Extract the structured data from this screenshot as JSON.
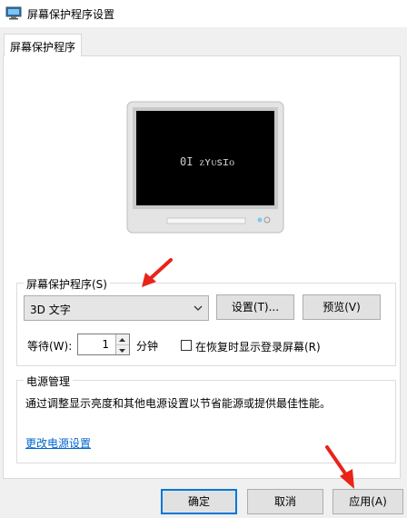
{
  "window": {
    "title": "屏幕保护程序设置"
  },
  "tab": {
    "label": "屏幕保护程序"
  },
  "preview": {
    "screen_text": "0I ᴢʏᴜꜱɪᴏ"
  },
  "screensaver": {
    "group_label": "屏幕保护程序(S)",
    "selected": "3D 文字",
    "settings_label": "设置(T)...",
    "preview_label": "预览(V)",
    "wait_label": "等待(W):",
    "wait_value": "1",
    "minutes_label": "分钟",
    "resume_label": "在恢复时显示登录屏幕(R)"
  },
  "power": {
    "group_label": "电源管理",
    "description": "通过调整显示亮度和其他电源设置以节省能源或提供最佳性能。",
    "link": "更改电源设置"
  },
  "footer": {
    "ok": "确定",
    "cancel": "取消",
    "apply": "应用(A)"
  },
  "annotations": {
    "arrow_color": "#e8231a"
  }
}
